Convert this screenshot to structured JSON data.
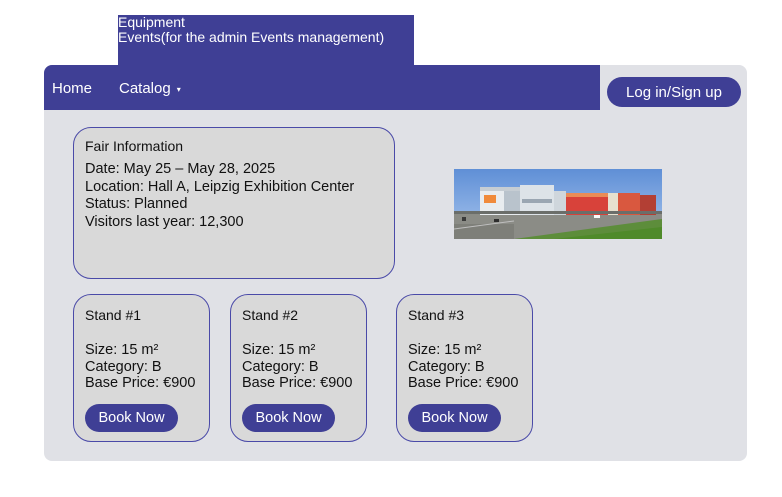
{
  "dropdown": {
    "items": [
      "Equipment",
      "Events(for the admin Events management)"
    ]
  },
  "nav": {
    "home": "Home",
    "catalog": "Catalog",
    "caret": "▾",
    "login": "Log in/Sign up"
  },
  "fair": {
    "title": "Fair Information",
    "date": "Date: May 25 – May 28, 2025",
    "location": "Location: Hall A, Leipzig Exhibition Center",
    "status": "Status: Planned",
    "visitors": "Visitors last year: 12,300"
  },
  "stands": [
    {
      "title": "Stand #1",
      "size": "Size: 15 m²",
      "category": "Category: B",
      "price": "Base Price: €900",
      "button": "Book Now"
    },
    {
      "title": "Stand #2",
      "size": "Size: 15 m²",
      "category": "Category: B",
      "price": "Base Price: €900",
      "button": "Book Now"
    },
    {
      "title": "Stand #3",
      "size": "Size: 15 m²",
      "category": "Category: B",
      "price": "Base Price: €900",
      "button": "Book Now"
    }
  ],
  "colors": {
    "primary": "#3f3f95",
    "app_background": "#e0e1e6",
    "card_background": "#d9d9d9"
  }
}
